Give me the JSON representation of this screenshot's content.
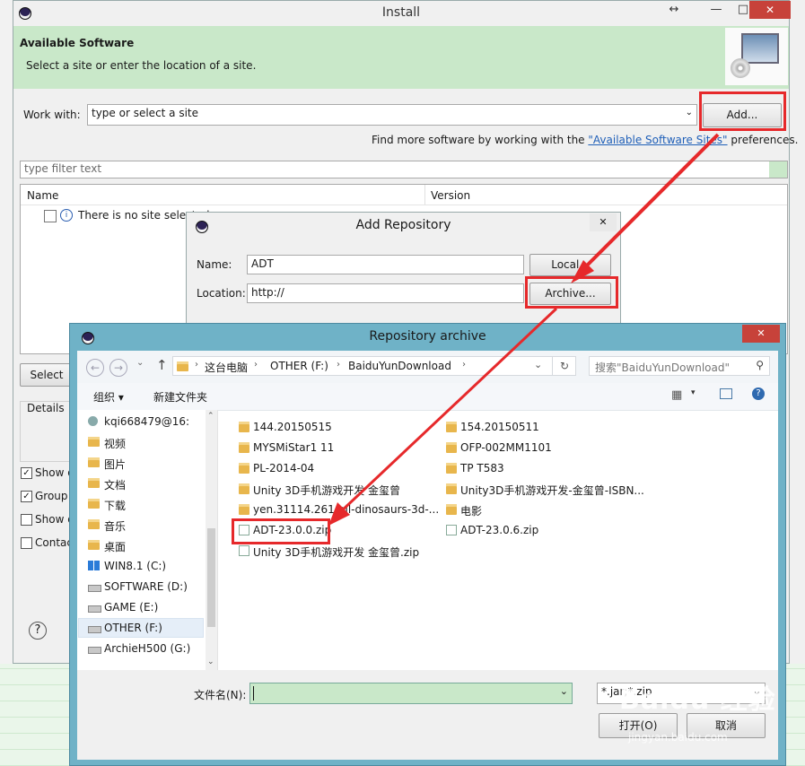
{
  "install": {
    "title": "Install",
    "resize_glyph": "↔",
    "minimize": "—",
    "maximize": "□",
    "close": "✕",
    "banner_heading": "Available Software",
    "banner_subtitle": "Select a site or enter the location of a site.",
    "work_with_label": "Work with:",
    "work_with_value": "type or select a site",
    "add_button": "Add...",
    "find_more_prefix": "Find more software by working with the",
    "find_more_link": "\"Available Software Sites\"",
    "find_more_suffix": "preferences.",
    "filter_placeholder": "type filter text",
    "col_name": "Name",
    "col_version": "Version",
    "no_site_text": "There is no site selected.",
    "select_button": "Select",
    "details_label": "Details",
    "checkboxes": [
      {
        "label": "Show o",
        "checked": true
      },
      {
        "label": "Group",
        "checked": true
      },
      {
        "label": "Show o",
        "checked": false
      },
      {
        "label": "Contac",
        "checked": false
      }
    ],
    "help_glyph": "?"
  },
  "add_repository": {
    "title": "Add Repository",
    "close": "✕",
    "name_label": "Name:",
    "name_value": "ADT",
    "location_label": "Location:",
    "location_value": "http://",
    "local_button": "Local...",
    "archive_button": "Archive..."
  },
  "archive_dialog": {
    "title": "Repository archive",
    "close": "✕",
    "breadcrumb": [
      "这台电脑",
      "OTHER (F:)",
      "BaiduYunDownload"
    ],
    "search_placeholder": "搜索\"BaiduYunDownload\"",
    "organize": "组织 ▾",
    "new_folder": "新建文件夹",
    "tree": [
      {
        "label": "kqi668479@16:",
        "type": "user"
      },
      {
        "label": "视频",
        "type": "folder"
      },
      {
        "label": "图片",
        "type": "folder"
      },
      {
        "label": "文档",
        "type": "folder"
      },
      {
        "label": "下载",
        "type": "folder"
      },
      {
        "label": "音乐",
        "type": "folder"
      },
      {
        "label": "桌面",
        "type": "folder"
      },
      {
        "label": "WIN8.1 (C:)",
        "type": "win"
      },
      {
        "label": "SOFTWARE (D:)",
        "type": "drive"
      },
      {
        "label": "GAME (E:)",
        "type": "drive"
      },
      {
        "label": "OTHER (F:)",
        "type": "drive",
        "selected": true
      },
      {
        "label": "ArchieH500 (G:)",
        "type": "drive"
      }
    ],
    "files_left": [
      {
        "label": "144.20150515",
        "type": "folder"
      },
      {
        "label": "MYSMiStar1 11",
        "type": "folder"
      },
      {
        "label": "PL-2014-04",
        "type": "folder"
      },
      {
        "label": "Unity 3D手机游戏开发 金玺曾",
        "type": "folder"
      },
      {
        "label": "yen.31114.261-all-dinosaurs-3d-...",
        "type": "folder"
      },
      {
        "label": "ADT-23.0.0.zip",
        "type": "zip"
      },
      {
        "label": "Unity 3D手机游戏开发 金玺曾.zip",
        "type": "zip"
      }
    ],
    "files_right": [
      {
        "label": "154.20150511",
        "type": "folder"
      },
      {
        "label": "OFP-002MM1101",
        "type": "folder"
      },
      {
        "label": "TP T583",
        "type": "folder"
      },
      {
        "label": "Unity3D手机游戏开发-金玺曾-ISBN...",
        "type": "folder"
      },
      {
        "label": "电影",
        "type": "folder"
      },
      {
        "label": "ADT-23.0.6.zip",
        "type": "zip"
      }
    ],
    "filename_label": "文件名(N):",
    "filename_value": "",
    "filter_value": "*.jar;*.zip",
    "open_button": "打开(O)",
    "cancel_button": "取消"
  },
  "watermark": {
    "brand": "Baidu 经验",
    "url": "jingyan.baidu.com"
  },
  "colors": {
    "banner": "#c9e8c9",
    "highlight": "#e6292b",
    "archive_frame": "#6fb2c7",
    "link": "#1f5fb8"
  }
}
